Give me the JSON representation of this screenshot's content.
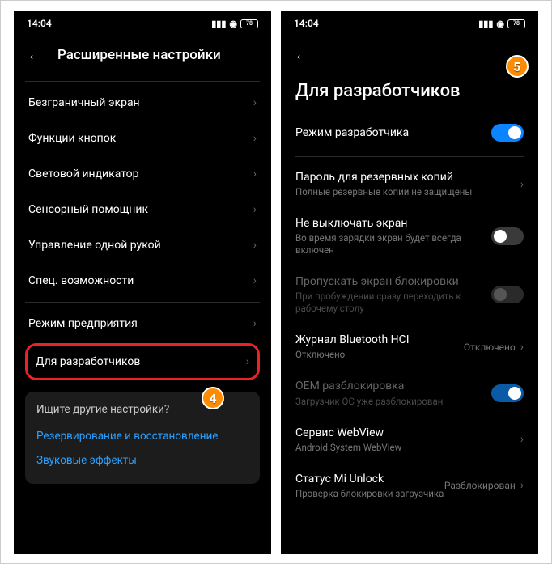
{
  "left": {
    "status": {
      "time": "14:04",
      "battery": "78"
    },
    "header": "Расширенные настройки",
    "items": [
      "Безграничный экран",
      "Функции кнопок",
      "Световой индикатор",
      "Сенсорный помощник",
      "Управление одной рукой",
      "Спец. возможности"
    ],
    "items2": [
      "Режим предприятия",
      "Для разработчиков"
    ],
    "suggest": {
      "title": "Ищите другие настройки?",
      "links": [
        "Резервирование и восстановление",
        "Звуковые эффекты"
      ]
    },
    "badge": "4"
  },
  "right": {
    "status": {
      "time": "14:04",
      "battery": "78"
    },
    "title": "Для разработчиков",
    "badge": "5",
    "items": [
      {
        "title": "Режим разработчика",
        "type": "switch",
        "on": true
      },
      {
        "type": "divider"
      },
      {
        "title": "Пароль для резервных копий",
        "sub": "Полные резервные копии не защищены",
        "type": "chevron"
      },
      {
        "title": "Не выключать экран",
        "sub": "Во время зарядки экран будет всегда включен",
        "type": "switch",
        "on": false
      },
      {
        "title": "Пропускать экран блокировки",
        "sub": "При пробуждении сразу переходить к рабочему столу",
        "type": "switch",
        "on": false,
        "disabled": true
      },
      {
        "title": "Журнал Bluetooth HCI",
        "sub": "Отключено",
        "type": "trail",
        "trail": "Отключено"
      },
      {
        "title": "OEM разблокировка",
        "sub": "Загрузчик ОС уже разблокирован",
        "type": "switch",
        "on": true,
        "disabled": true
      },
      {
        "title": "Сервис WebView",
        "sub": "Android System WebView",
        "type": "chevron"
      },
      {
        "title": "Статус Mi Unlock",
        "sub": "Проверка блокировки загрузчика",
        "type": "trail",
        "trail": "Разблокирован"
      }
    ]
  }
}
